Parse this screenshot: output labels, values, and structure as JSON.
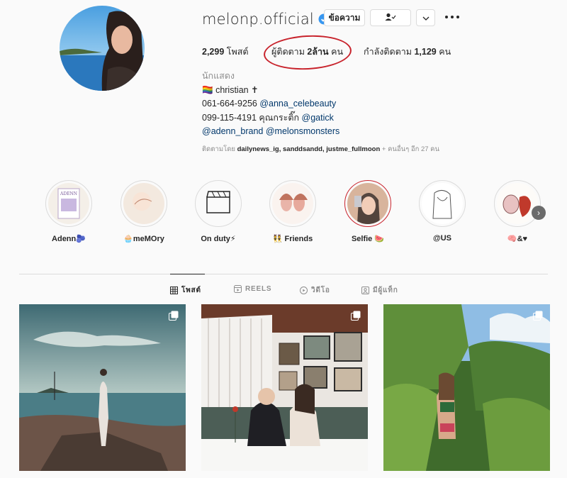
{
  "profile": {
    "username": "melonp.official",
    "verified": true,
    "message_button": "ข้อความ",
    "stats": {
      "posts": "2,299",
      "posts_label": "โพสต์",
      "followers_label": "ผู้ติดตาม",
      "followers": "2ล้าน",
      "followers_unit": "คน",
      "following_label": "กำลังติดตาม",
      "following": "1,129",
      "following_unit": "คน"
    },
    "bio": {
      "category": "นักแสดง",
      "line1": "christian ✝",
      "line2_phone": "061-664-9256",
      "line2_handle": "@anna_celebeauty",
      "line3_phone": "099-115-4191",
      "line3_name": "คุณกระติ๊ก",
      "line3_handle": "@gatick",
      "line4_handle1": "@adenn_brand",
      "line4_handle2": "@melonsmonsters"
    },
    "followed_by": {
      "prefix": "ติดตามโดย",
      "names": "dailynews_ig, sanddsandd, justme_fullmoon",
      "suffix": "+ คนอื่นๆ อีก 27 คน"
    }
  },
  "highlights": [
    {
      "label": "Adenn🫐"
    },
    {
      "label": "🧁meMOry"
    },
    {
      "label": "On duty⚡"
    },
    {
      "label": "👯 Friends"
    },
    {
      "label": "Selfie 🍉"
    },
    {
      "label": "@US"
    },
    {
      "label": "🧠&♥"
    }
  ],
  "tabs": [
    {
      "label": "โพสต์",
      "icon": "grid-icon"
    },
    {
      "label": "REELS",
      "icon": "reels-icon"
    },
    {
      "label": "วิดีโอ",
      "icon": "video-icon"
    },
    {
      "label": "มีผู้แท็ก",
      "icon": "tag-icon"
    }
  ],
  "colors": {
    "verified": "#3897f0",
    "annotation_circle": "#c8232c",
    "link": "#00376b",
    "muted": "#8e8e8e"
  }
}
